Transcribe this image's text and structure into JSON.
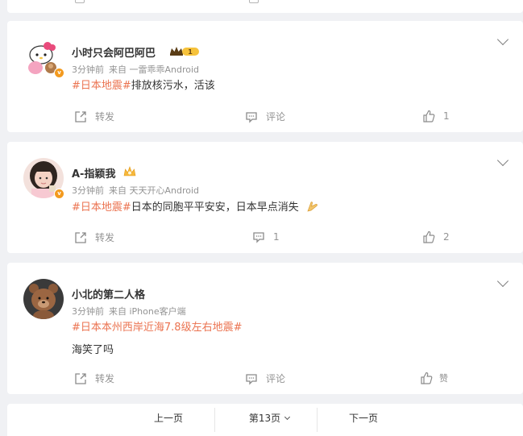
{
  "posts": [
    {
      "username": "小时只会阿巴阿巴",
      "member_level": "1",
      "time": "3分钟前",
      "source": "来自 一雷乖乖Android",
      "hashtag": "#日本地震#",
      "text": "排放核污水，活该",
      "line2": "",
      "repost_label": "转发",
      "comment_label": "评论",
      "like_count": "1"
    },
    {
      "username": "A-指颖我",
      "time": "3分钟前",
      "source": "来自 天天开心Android",
      "hashtag": "#日本地震#",
      "text": "日本的同胞平平安安，日本早点消失",
      "repost_label": "转发",
      "comment_count": "1",
      "like_count": "2"
    },
    {
      "username": "小北的第二人格",
      "time": "3分钟前",
      "source": "来自 iPhone客户端",
      "hashtag": "#日本本州西岸近海7.8级左右地震#",
      "text": "海笑了吗",
      "repost_label": "转发",
      "comment_label": "评论",
      "like_label": "赞"
    }
  ],
  "pagination": {
    "prev": "上一页",
    "current": "第13页",
    "next": "下一页"
  },
  "colors": {
    "accent": "#eb7350",
    "background": "#f0f1f4",
    "meta": "#939393",
    "verified_badge": "#f39a1f"
  }
}
